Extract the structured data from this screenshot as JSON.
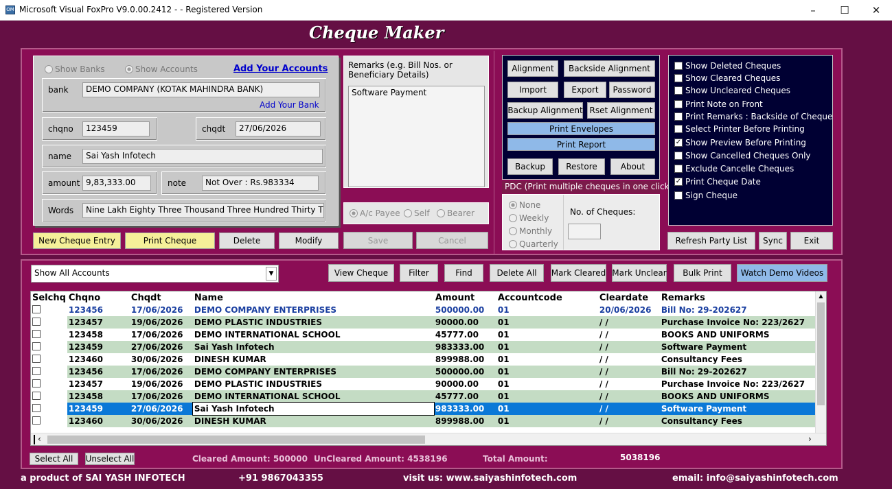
{
  "window": {
    "title": "Microsoft Visual FoxPro V9.0.00.2412 - - Registered Version",
    "icon": "app-icon"
  },
  "heading": "Cheque Maker",
  "filters": {
    "show_banks": "Show Banks",
    "show_accounts": "Show Accounts",
    "add_accounts": "Add Your Accounts"
  },
  "form": {
    "bank_label": "bank",
    "bank_value": "DEMO COMPANY (KOTAK MAHINDRA BANK)",
    "add_bank": "Add Your Bank",
    "chqno_label": "chqno",
    "chqno_value": "123459",
    "chqdt_label": "chqdt",
    "chqdt_value": "27/06/2026",
    "name_label": "name",
    "name_value": "Sai Yash Infotech",
    "amount_label": "amount",
    "amount_value": "9,83,333.00",
    "note_label": "note",
    "note_value": "Not Over : Rs.983334",
    "words_label": "Words",
    "words_value": "Nine Lakh Eighty Three Thousand Three Hundred Thirty Thre"
  },
  "remarks": {
    "label": "Remarks (e.g. Bill Nos. or Beneficiary Details)",
    "value": "Software Payment"
  },
  "payee": {
    "ac": "A/c Payee",
    "self": "Self",
    "bearer": "Bearer"
  },
  "buttons": {
    "new": "New Cheque Entry",
    "print": "Print Cheque",
    "delete": "Delete",
    "modify": "Modify",
    "save": "Save",
    "cancel": "Cancel",
    "alignment": "Alignment",
    "backside": "Backside Alignment",
    "import": "Import",
    "export": "Export",
    "password": "Password",
    "backup_align": "Backup Alignment",
    "reset_align": "Rset Alignment",
    "envelopes": "Print Envelopes",
    "report": "Print Report",
    "backup": "Backup",
    "restore": "Restore",
    "about": "About",
    "refresh": "Refresh Party List",
    "sync": "Sync",
    "exit": "Exit",
    "view": "View Cheque",
    "filter": "Filter",
    "find": "Find",
    "delete_all": "Delete All",
    "mark_cleared": "Mark Cleared",
    "mark_unclear": "Mark Unclear",
    "bulk": "Bulk Print",
    "demo": "Watch Demo Videos",
    "select_all": "Select All",
    "unselect_all": "Unselect All"
  },
  "pdc": {
    "title": "PDC (Print multiple cheques in one click)",
    "none": "None",
    "weekly": "Weekly",
    "monthly": "Monthly",
    "quarterly": "Quarterly",
    "count_label": "No. of Cheques:"
  },
  "options": [
    {
      "label": "Show Deleted Cheques",
      "checked": ""
    },
    {
      "label": "Show Cleared Cheques",
      "checked": ""
    },
    {
      "label": "Show Uncleared Cheques",
      "checked": ""
    },
    {
      "label": "Print Note on Front",
      "checked": ""
    },
    {
      "label": "Print Remarks : Backside of Cheque",
      "checked": ""
    },
    {
      "label": "Select Printer Before Printing",
      "checked": ""
    },
    {
      "label": "Show Preview Before Printing",
      "checked": "✓"
    },
    {
      "label": "Show Cancelled Cheques Only",
      "checked": ""
    },
    {
      "label": "Exclude Cancelle Cheques",
      "checked": ""
    },
    {
      "label": "Print Cheque Date",
      "checked": "✓"
    },
    {
      "label": "Sign Cheque",
      "checked": ""
    }
  ],
  "account_filter": "Show All Accounts",
  "table": {
    "headers": [
      "Selchq",
      "Chqno",
      "Chqdt",
      "Name",
      "Amount",
      "Accountcode",
      "Cleardate",
      "Remarks"
    ],
    "rows": [
      [
        "123456",
        "17/06/2026",
        "DEMO COMPANY ENTERPRISES",
        "500000.00",
        "01",
        "20/06/2026",
        "Bill No: 29-202627"
      ],
      [
        "123457",
        "19/06/2026",
        "DEMO PLASTIC INDUSTRIES",
        "90000.00",
        "01",
        "/ /",
        "Purchase Invoice No: 223/2627"
      ],
      [
        "123458",
        "17/06/2026",
        "DEMO INTERNATIONAL SCHOOL",
        "45777.00",
        "01",
        "/ /",
        "BOOKS AND UNIFORMS"
      ],
      [
        "123459",
        "27/06/2026",
        "Sai Yash Infotech",
        "983333.00",
        "01",
        "/ /",
        "Software Payment"
      ],
      [
        "123460",
        "30/06/2026",
        "DINESH KUMAR",
        "899988.00",
        "01",
        "/ /",
        "Consultancy Fees"
      ],
      [
        "123456",
        "17/06/2026",
        "DEMO COMPANY ENTERPRISES",
        "500000.00",
        "01",
        "/ /",
        "Bill No: 29-202627"
      ],
      [
        "123457",
        "19/06/2026",
        "DEMO PLASTIC INDUSTRIES",
        "90000.00",
        "01",
        "/ /",
        "Purchase Invoice No: 223/2627"
      ],
      [
        "123458",
        "17/06/2026",
        "DEMO INTERNATIONAL SCHOOL",
        "45777.00",
        "01",
        "/ /",
        "BOOKS AND UNIFORMS"
      ],
      [
        "123459",
        "27/06/2026",
        "Sai Yash Infotech",
        "983333.00",
        "01",
        "/ /",
        "Software Payment"
      ],
      [
        "123460",
        "30/06/2026",
        "DINESH KUMAR",
        "899988.00",
        "01",
        "/ /",
        "Consultancy Fees"
      ]
    ]
  },
  "summary": {
    "cleared": "Cleared Amount: 500000",
    "uncleared": "UnCleared Amount: 4538196",
    "total_label": "Total Amount:",
    "total_value": "5038196"
  },
  "footer": {
    "product": "a product of   SAI YASH INFOTECH",
    "phone": "+91 9867043355",
    "web": "visit us: www.saiyashinfotech.com",
    "email": "email: info@saiyashinfotech.com"
  }
}
